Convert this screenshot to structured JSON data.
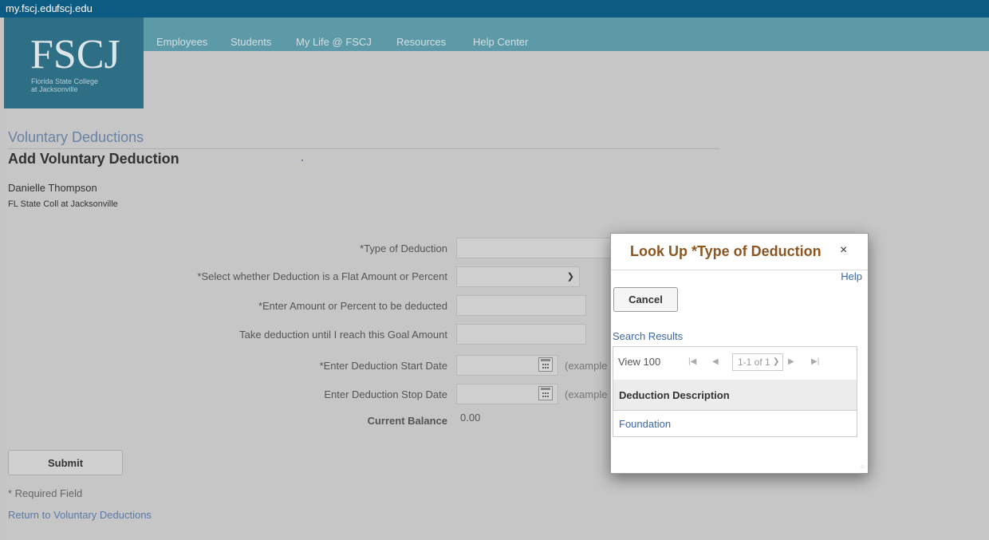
{
  "topbar": {
    "links": [
      "my.fscj.edu",
      "fscj.edu"
    ]
  },
  "header": {
    "logo_text": "FSCJ",
    "logo_subtitle": "Florida State College\nat Jacksonville",
    "nav": [
      "Employees",
      "Students",
      "My Life @ FSCJ",
      "Resources",
      "Help Center"
    ]
  },
  "page": {
    "title": "Voluntary Deductions",
    "subtitle": "Add Voluntary Deduction",
    "employee_name": "Danielle Thompson",
    "company": "FL State Coll at Jacksonville"
  },
  "form": {
    "type_label": "*Type of Deduction",
    "type_value": "",
    "flat_pct_label": "*Select whether Deduction is a Flat Amount or Percent",
    "flat_pct_value": "",
    "amount_label": "*Enter Amount or Percent to be deducted",
    "amount_value": "",
    "goal_label": "Take deduction until I reach this Goal Amount",
    "goal_value": "",
    "start_label": "*Enter Deduction Start Date",
    "start_value": "",
    "stop_label": "Enter Deduction Stop Date",
    "stop_value": "",
    "date_hint": "(example",
    "balance_label": "Current Balance",
    "balance_value": "0.00",
    "submit_label": "Submit",
    "required_note": "* Required Field",
    "return_link": "Return to Voluntary Deductions"
  },
  "modal": {
    "title": "Look Up *Type of Deduction",
    "close": "×",
    "help": "Help",
    "cancel": "Cancel",
    "results_label": "Search Results",
    "view_label": "View 100",
    "pager": "1-1 of 1",
    "column_header": "Deduction Description",
    "rows": [
      "Foundation"
    ]
  },
  "icons": {
    "calendar": "calendar-icon",
    "close": "close-icon",
    "chevron": "chevron-down-icon"
  }
}
